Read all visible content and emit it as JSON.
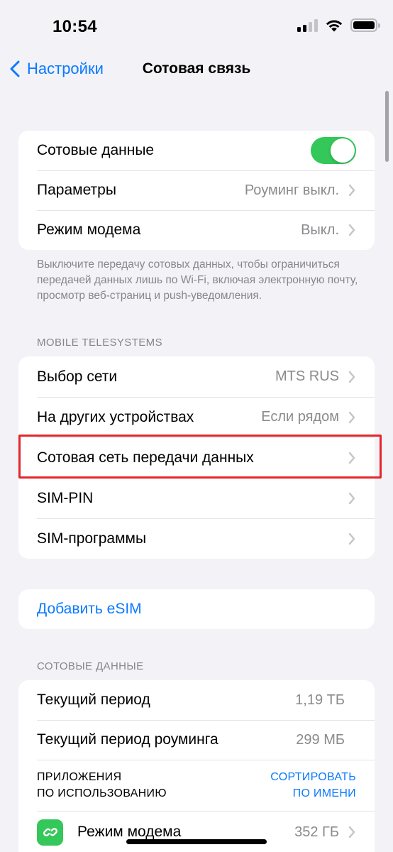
{
  "status_bar": {
    "time": "10:54"
  },
  "nav": {
    "back_label": "Настройки",
    "title": "Сотовая связь"
  },
  "group1": {
    "cellular_data_label": "Сотовые данные",
    "cellular_data_on": true,
    "params_label": "Параметры",
    "params_value": "Роуминг выкл.",
    "hotspot_label": "Режим модема",
    "hotspot_value": "Выкл."
  },
  "footnote1": "Выключите передачу сотовых данных, чтобы ограничиться передачей данных лишь по Wi-Fi, включая электронную почту, просмотр веб-страниц и push-уведомления.",
  "carrier_section": {
    "header": "MOBILE TELESYSTEMS",
    "network_select_label": "Выбор сети",
    "network_select_value": "MTS RUS",
    "other_devices_label": "На других устройствах",
    "other_devices_value": "Если рядом",
    "data_network_label": "Сотовая сеть передачи данных",
    "sim_pin_label": "SIM-PIN",
    "sim_apps_label": "SIM-программы"
  },
  "esim": {
    "add_label": "Добавить eSIM"
  },
  "usage_section": {
    "header": "СОТОВЫЕ ДАННЫЕ",
    "current_period_label": "Текущий период",
    "current_period_value": "1,19 ТБ",
    "roaming_period_label": "Текущий период роуминга",
    "roaming_period_value": "299 МБ",
    "apps_header_line1": "ПРИЛОЖЕНИЯ",
    "apps_header_line2": "ПО ИСПОЛЬЗОВАНИЮ",
    "sort_line1": "СОРТИРОВАТЬ",
    "sort_line2": "ПО ИМЕНИ",
    "apps": [
      {
        "name": "Режим модема",
        "value": "352 ГБ",
        "icon": "hotspot-link-icon"
      }
    ]
  },
  "colors": {
    "accent": "#0a7aff",
    "toggle_on": "#34c759",
    "highlight": "#e3262b"
  }
}
